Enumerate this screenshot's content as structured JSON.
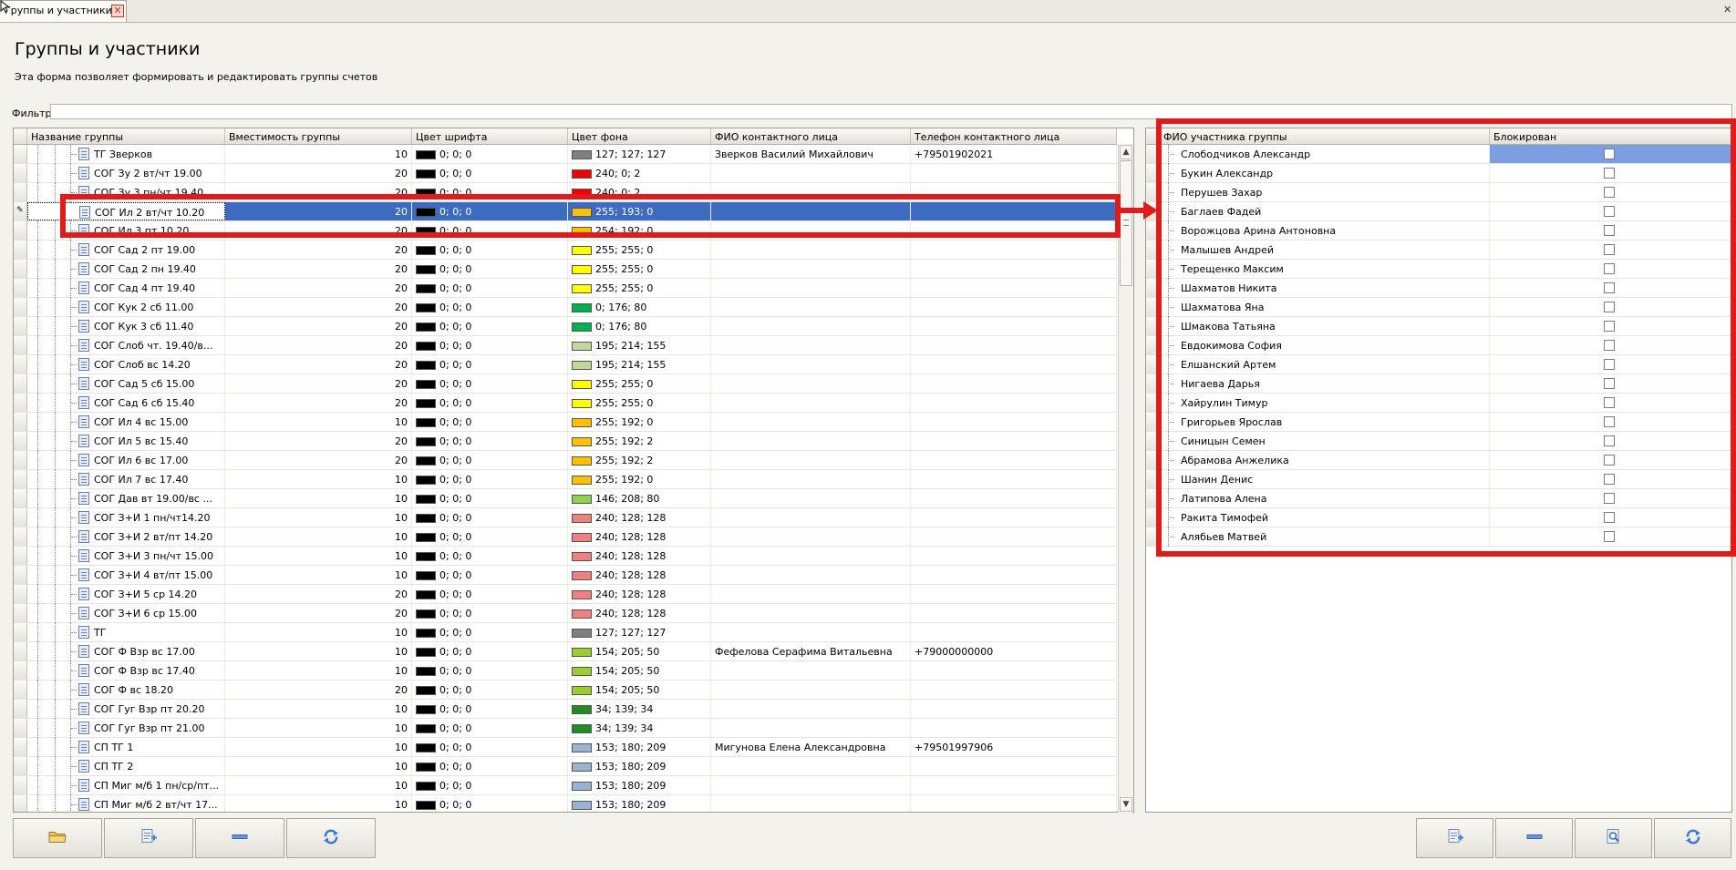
{
  "tab": {
    "title": "Группы и участники",
    "close_symbol": "✕"
  },
  "header": {
    "title": "Группы и участники",
    "description": "Эта форма позволяет формировать и редактировать группы счетов"
  },
  "filter": {
    "label": "Фильтр",
    "value": ""
  },
  "groups_grid": {
    "columns": [
      "Название группы",
      "Вместимость группы",
      "Цвет шрифта",
      "Цвет фона",
      "ФИО контактного лица",
      "Телефон контактного лица"
    ],
    "selected_row_index": 3,
    "rows": [
      {
        "name": "ТГ Зверков",
        "capacity": "10",
        "font_color": "0; 0; 0",
        "font_hex": "#000000",
        "bg_color": "127; 127; 127",
        "bg_hex": "#7f7f7f",
        "contact": "Зверков Василий Михайлович",
        "phone": "+79501902021"
      },
      {
        "name": "СОГ Зу 2 вт/чт 19.00",
        "capacity": "20",
        "font_color": "0; 0; 0",
        "font_hex": "#000000",
        "bg_color": "240; 0; 2",
        "bg_hex": "#f00002",
        "contact": "",
        "phone": ""
      },
      {
        "name": "СОГ Зу 3 пн/чт 19.40",
        "capacity": "20",
        "font_color": "0; 0; 0",
        "font_hex": "#000000",
        "bg_color": "240; 0; 2",
        "bg_hex": "#f00002",
        "contact": "",
        "phone": ""
      },
      {
        "name": "СОГ Ил 2 вт/чт 10.20",
        "capacity": "20",
        "font_color": "0; 0; 0",
        "font_hex": "#000000",
        "bg_color": "255; 193; 0",
        "bg_hex": "#ffc100",
        "contact": "",
        "phone": ""
      },
      {
        "name": "СОГ Ил 3 пт 10.20",
        "capacity": "20",
        "font_color": "0; 0; 0",
        "font_hex": "#000000",
        "bg_color": "254; 192; 0",
        "bg_hex": "#fec000",
        "contact": "",
        "phone": ""
      },
      {
        "name": "СОГ Сад 2 пт 19.00",
        "capacity": "20",
        "font_color": "0; 0; 0",
        "font_hex": "#000000",
        "bg_color": "255; 255; 0",
        "bg_hex": "#ffff00",
        "contact": "",
        "phone": ""
      },
      {
        "name": "СОГ Сад 2 пн 19.40",
        "capacity": "20",
        "font_color": "0; 0; 0",
        "font_hex": "#000000",
        "bg_color": "255; 255; 0",
        "bg_hex": "#ffff00",
        "contact": "",
        "phone": ""
      },
      {
        "name": "СОГ Сад 4 пт 19.40",
        "capacity": "20",
        "font_color": "0; 0; 0",
        "font_hex": "#000000",
        "bg_color": "255; 255; 0",
        "bg_hex": "#ffff00",
        "contact": "",
        "phone": ""
      },
      {
        "name": "СОГ Кук 2 сб 11.00",
        "capacity": "20",
        "font_color": "0; 0; 0",
        "font_hex": "#000000",
        "bg_color": "0; 176; 80",
        "bg_hex": "#00b050",
        "contact": "",
        "phone": ""
      },
      {
        "name": "СОГ Кук 3 сб 11.40",
        "capacity": "20",
        "font_color": "0; 0; 0",
        "font_hex": "#000000",
        "bg_color": "0; 176; 80",
        "bg_hex": "#00b050",
        "contact": "",
        "phone": ""
      },
      {
        "name": "СОГ Слоб чт. 19.40/в...",
        "capacity": "20",
        "font_color": "0; 0; 0",
        "font_hex": "#000000",
        "bg_color": "195; 214; 155",
        "bg_hex": "#c3d69b",
        "contact": "",
        "phone": ""
      },
      {
        "name": "СОГ Слоб вс 14.20",
        "capacity": "20",
        "font_color": "0; 0; 0",
        "font_hex": "#000000",
        "bg_color": "195; 214; 155",
        "bg_hex": "#c3d69b",
        "contact": "",
        "phone": ""
      },
      {
        "name": "СОГ Сад 5 сб 15.00",
        "capacity": "20",
        "font_color": "0; 0; 0",
        "font_hex": "#000000",
        "bg_color": "255; 255; 0",
        "bg_hex": "#ffff00",
        "contact": "",
        "phone": ""
      },
      {
        "name": "СОГ Сад 6 сб 15.40",
        "capacity": "20",
        "font_color": "0; 0; 0",
        "font_hex": "#000000",
        "bg_color": "255; 255; 0",
        "bg_hex": "#ffff00",
        "contact": "",
        "phone": ""
      },
      {
        "name": "СОГ Ил 4 вс 15.00",
        "capacity": "10",
        "font_color": "0; 0; 0",
        "font_hex": "#000000",
        "bg_color": "255; 192; 0",
        "bg_hex": "#ffc000",
        "contact": "",
        "phone": ""
      },
      {
        "name": "СОГ Ил 5 вс 15.40",
        "capacity": "20",
        "font_color": "0; 0; 0",
        "font_hex": "#000000",
        "bg_color": "255; 192; 2",
        "bg_hex": "#ffc002",
        "contact": "",
        "phone": ""
      },
      {
        "name": "СОГ Ил 6 вс 17.00",
        "capacity": "20",
        "font_color": "0; 0; 0",
        "font_hex": "#000000",
        "bg_color": "255; 192; 2",
        "bg_hex": "#ffc002",
        "contact": "",
        "phone": ""
      },
      {
        "name": "СОГ Ил 7 вс 17.40",
        "capacity": "10",
        "font_color": "0; 0; 0",
        "font_hex": "#000000",
        "bg_color": "255; 192; 0",
        "bg_hex": "#ffc000",
        "contact": "",
        "phone": ""
      },
      {
        "name": "СОГ Дав вт 19.00/вс ...",
        "capacity": "10",
        "font_color": "0; 0; 0",
        "font_hex": "#000000",
        "bg_color": "146; 208; 80",
        "bg_hex": "#92d050",
        "contact": "",
        "phone": ""
      },
      {
        "name": "СОГ З+И 1 пн/чт14.20",
        "capacity": "10",
        "font_color": "0; 0; 0",
        "font_hex": "#000000",
        "bg_color": "240; 128; 128",
        "bg_hex": "#f08080",
        "contact": "",
        "phone": ""
      },
      {
        "name": "СОГ З+И 2 вт/пт 14.20",
        "capacity": "10",
        "font_color": "0; 0; 0",
        "font_hex": "#000000",
        "bg_color": "240; 128; 128",
        "bg_hex": "#f08080",
        "contact": "",
        "phone": ""
      },
      {
        "name": "СОГ З+И 3 пн/чт 15.00",
        "capacity": "10",
        "font_color": "0; 0; 0",
        "font_hex": "#000000",
        "bg_color": "240; 128; 128",
        "bg_hex": "#f08080",
        "contact": "",
        "phone": ""
      },
      {
        "name": "СОГ З+И 4 вт/пт 15.00",
        "capacity": "10",
        "font_color": "0; 0; 0",
        "font_hex": "#000000",
        "bg_color": "240; 128; 128",
        "bg_hex": "#f08080",
        "contact": "",
        "phone": ""
      },
      {
        "name": "СОГ З+И 5 ср 14.20",
        "capacity": "20",
        "font_color": "0; 0; 0",
        "font_hex": "#000000",
        "bg_color": "240; 128; 128",
        "bg_hex": "#f08080",
        "contact": "",
        "phone": ""
      },
      {
        "name": "СОГ З+И 6 ср 15.00",
        "capacity": "20",
        "font_color": "0; 0; 0",
        "font_hex": "#000000",
        "bg_color": "240; 128; 128",
        "bg_hex": "#f08080",
        "contact": "",
        "phone": ""
      },
      {
        "name": "ТГ",
        "capacity": "10",
        "font_color": "0; 0; 0",
        "font_hex": "#000000",
        "bg_color": "127; 127; 127",
        "bg_hex": "#7f7f7f",
        "contact": "",
        "phone": ""
      },
      {
        "name": "СОГ Ф Взр вс 17.00",
        "capacity": "10",
        "font_color": "0; 0; 0",
        "font_hex": "#000000",
        "bg_color": "154; 205; 50",
        "bg_hex": "#9acd32",
        "contact": "Фефелова Серафима Витальевна",
        "phone": "+79000000000"
      },
      {
        "name": "СОГ Ф Взр вс 17.40",
        "capacity": "10",
        "font_color": "0; 0; 0",
        "font_hex": "#000000",
        "bg_color": "154; 205; 50",
        "bg_hex": "#9acd32",
        "contact": "",
        "phone": ""
      },
      {
        "name": "СОГ Ф вс 18.20",
        "capacity": "20",
        "font_color": "0; 0; 0",
        "font_hex": "#000000",
        "bg_color": "154; 205; 50",
        "bg_hex": "#9acd32",
        "contact": "",
        "phone": ""
      },
      {
        "name": "СОГ Гуг Взр пт 20.20",
        "capacity": "10",
        "font_color": "0; 0; 0",
        "font_hex": "#000000",
        "bg_color": "34; 139; 34",
        "bg_hex": "#228b22",
        "contact": "",
        "phone": ""
      },
      {
        "name": "СОГ Гуг Взр пт 21.00",
        "capacity": "10",
        "font_color": "0; 0; 0",
        "font_hex": "#000000",
        "bg_color": "34; 139; 34",
        "bg_hex": "#228b22",
        "contact": "",
        "phone": ""
      },
      {
        "name": "СП ТГ 1",
        "capacity": "10",
        "font_color": "0; 0; 0",
        "font_hex": "#000000",
        "bg_color": "153; 180; 209",
        "bg_hex": "#99b4d1",
        "contact": "Мигунова Елена Александровна",
        "phone": "+79501997906"
      },
      {
        "name": "СП ТГ 2",
        "capacity": "10",
        "font_color": "0; 0; 0",
        "font_hex": "#000000",
        "bg_color": "153; 180; 209",
        "bg_hex": "#99b4d1",
        "contact": "",
        "phone": ""
      },
      {
        "name": "СП Миг м/б 1 пн/ср/пт...",
        "capacity": "10",
        "font_color": "0; 0; 0",
        "font_hex": "#000000",
        "bg_color": "153; 180; 209",
        "bg_hex": "#99b4d1",
        "contact": "",
        "phone": ""
      },
      {
        "name": "СП Миг м/б 2 вт/чт 17...",
        "capacity": "10",
        "font_color": "0; 0; 0",
        "font_hex": "#000000",
        "bg_color": "153; 180; 209",
        "bg_hex": "#99b4d1",
        "contact": "",
        "phone": ""
      }
    ]
  },
  "members_grid": {
    "columns": [
      "ФИО участника группы",
      "Блокирован"
    ],
    "selected_row_index": 0,
    "rows": [
      {
        "name": "Слободчиков Александр",
        "blocked": false
      },
      {
        "name": "Букин Александр",
        "blocked": false
      },
      {
        "name": "Перушев Захар",
        "blocked": false
      },
      {
        "name": "Баглаев Фадей",
        "blocked": false
      },
      {
        "name": "Ворожцова Арина Антоновна",
        "blocked": false
      },
      {
        "name": "Малышев Андрей",
        "blocked": false
      },
      {
        "name": "Терещенко Максим",
        "blocked": false
      },
      {
        "name": "Шахматов Никита",
        "blocked": false
      },
      {
        "name": "Шахматова Яна",
        "blocked": false
      },
      {
        "name": "Шмакова Татьяна",
        "blocked": false
      },
      {
        "name": "Евдокимова София",
        "blocked": false
      },
      {
        "name": "Елшанский Артем",
        "blocked": false
      },
      {
        "name": "Нигаева Дарья",
        "blocked": false
      },
      {
        "name": "Хайрулин Тимур",
        "blocked": false
      },
      {
        "name": "Григорьев Ярослав",
        "blocked": false
      },
      {
        "name": "Синицын Семен",
        "blocked": false
      },
      {
        "name": "Абрамова Анжелика",
        "blocked": false
      },
      {
        "name": "Шанин Денис",
        "blocked": false
      },
      {
        "name": "Латипова Алена",
        "blocked": false
      },
      {
        "name": "Ракита Тимофей",
        "blocked": false
      },
      {
        "name": "Алябьев Матвей",
        "blocked": false
      }
    ]
  },
  "left_toolbar": [
    {
      "name": "open-group-button",
      "icon": "folder-icon"
    },
    {
      "name": "add-group-button",
      "icon": "add-doc-icon"
    },
    {
      "name": "remove-group-button",
      "icon": "minus-icon"
    },
    {
      "name": "refresh-groups-button",
      "icon": "refresh-icon"
    }
  ],
  "right_toolbar": [
    {
      "name": "add-member-button",
      "icon": "add-doc-icon"
    },
    {
      "name": "remove-member-button",
      "icon": "minus-icon"
    },
    {
      "name": "find-member-button",
      "icon": "search-doc-icon"
    },
    {
      "name": "refresh-members-button",
      "icon": "refresh-icon"
    }
  ],
  "colors": {
    "selection": "#3d6bbf",
    "annotation": "#e01b1b",
    "member_selected": "#7b9fe0"
  }
}
